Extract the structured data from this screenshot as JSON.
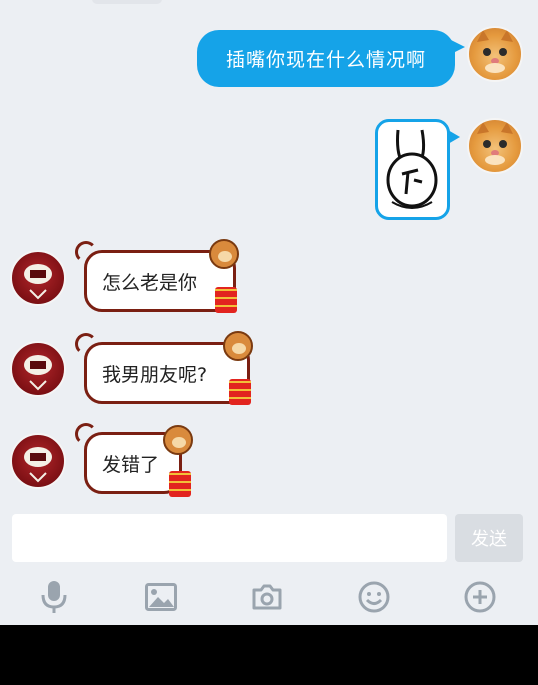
{
  "messages": [
    {
      "side": "out",
      "type": "text",
      "text": "插嘴你现在什么情况啊"
    },
    {
      "side": "out",
      "type": "sticker",
      "sticker": "rabbit-sticker"
    },
    {
      "side": "in",
      "type": "text",
      "text": "怎么老是你"
    },
    {
      "side": "in",
      "type": "text",
      "text": "我男朋友呢?"
    },
    {
      "side": "in",
      "type": "text",
      "text": "发错了"
    }
  ],
  "input": {
    "value": "",
    "placeholder": ""
  },
  "send_label": "发送",
  "toolbar": [
    "microphone-icon",
    "image-icon",
    "camera-icon",
    "emoji-icon",
    "plus-icon"
  ],
  "colors": {
    "outgoing": "#15a3e8",
    "incoming_border": "#7a1f12",
    "background": "#eceff3"
  }
}
